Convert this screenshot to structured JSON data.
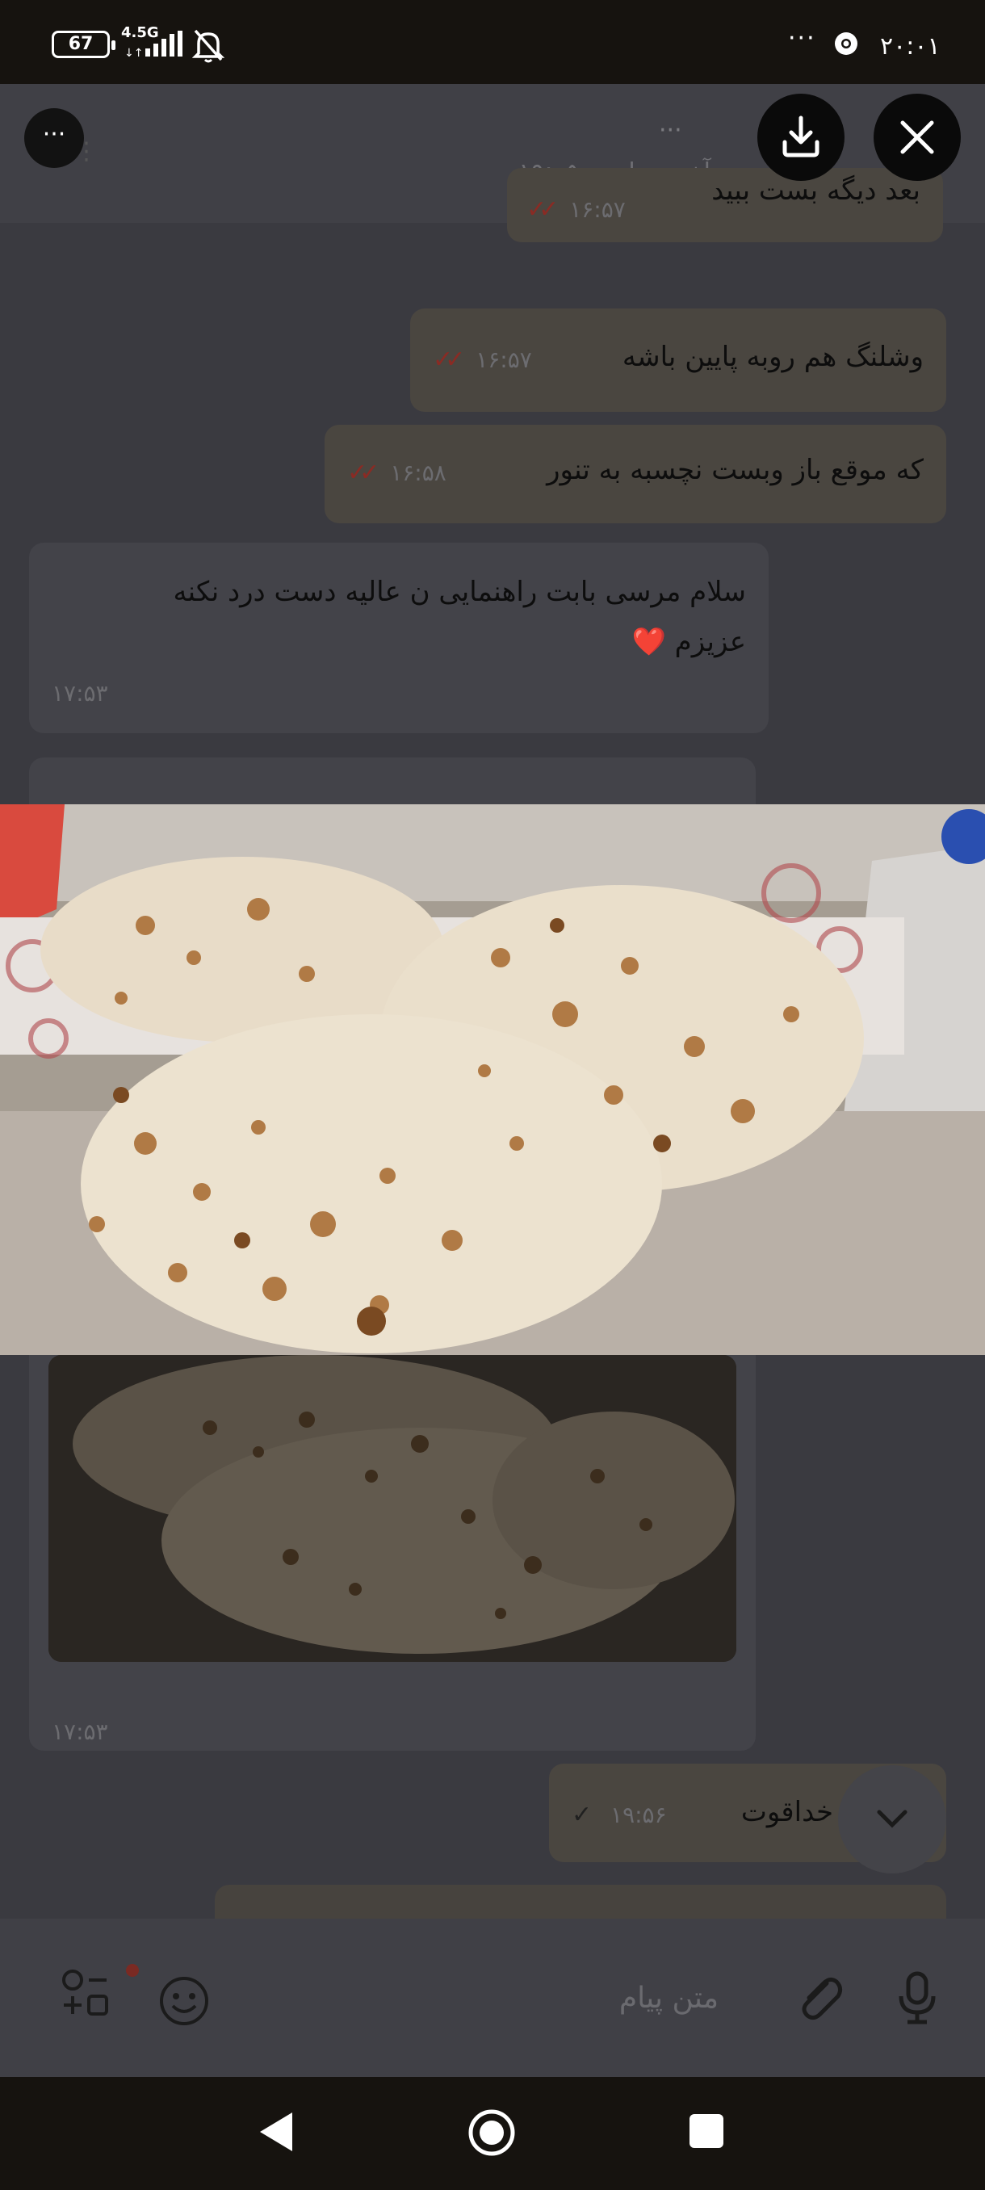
{
  "status_bar": {
    "battery": "67",
    "network": "4.5G",
    "overflow": "···",
    "clock": "۲۰:۰۱"
  },
  "header": {
    "menu": "···",
    "last_seen": "آخرین بازدید ۱۹:۰۵"
  },
  "messages": [
    {
      "id": "m1",
      "dir": "out",
      "text": "بعد دیگه بست ببید",
      "time": "۱۶:۵۷",
      "status": "read"
    },
    {
      "id": "m2",
      "dir": "out",
      "text": "وشلنگ هم روبه پایین باشه",
      "time": "۱۶:۵۷",
      "status": "read"
    },
    {
      "id": "m3",
      "dir": "out",
      "text": "که موقع باز وبست نچسبه به تنور",
      "time": "۱۶:۵۸",
      "status": "read"
    },
    {
      "id": "m4",
      "dir": "in",
      "text_line1": "سلام مرسی بابت راهنمایی ن عالیه دست درد نکنه",
      "text_line2": "عزیزم ❤️",
      "time": "۱۷:۵۳"
    },
    {
      "id": "m5",
      "dir": "in",
      "type": "photo",
      "time": "۱۷:۵۳"
    },
    {
      "id": "m6",
      "dir": "out",
      "text": "خداقوت",
      "time": "۱۹:۵۶",
      "status": "sent"
    }
  ],
  "composer": {
    "placeholder": "متن پیام"
  },
  "viewer": {
    "more": "···"
  },
  "colors": {
    "read_tick": "#e0463b",
    "status_bar_bg": "#16130f"
  }
}
